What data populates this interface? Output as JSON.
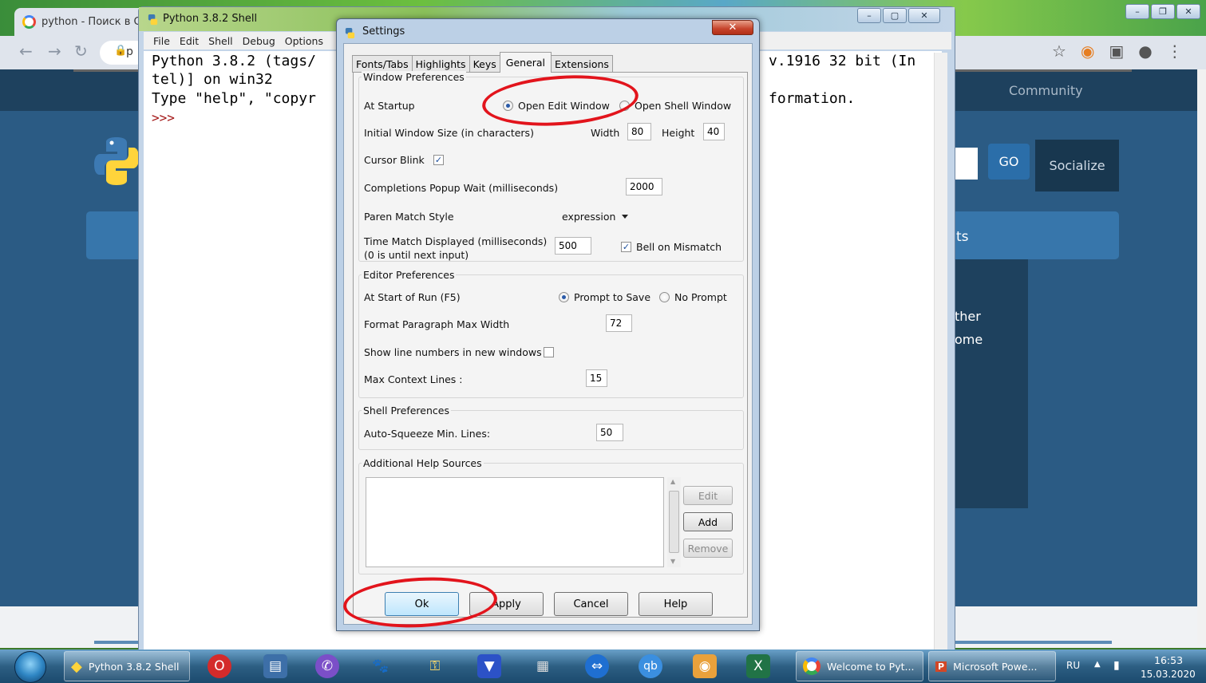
{
  "chrome": {
    "tab_title": "python - Поиск в G",
    "omnibox_text": "p"
  },
  "site": {
    "community": "Community",
    "go": "GO",
    "socialize": "Socialize",
    "band_text": "ts",
    "text_1": "ther",
    "text_2": "ome"
  },
  "shell": {
    "title": "Python 3.8.2 Shell",
    "menu": [
      "File",
      "Edit",
      "Shell",
      "Debug",
      "Options"
    ],
    "lines": [
      "Python 3.8.2 (tags/",
      "tel)] on win32",
      "Type \"help\", \"copyr",
      ">>>"
    ],
    "line_right_1": "v.1916 32 bit (In",
    "line_right_3": "formation."
  },
  "settings": {
    "title": "Settings",
    "close": "✕",
    "tabs": [
      "Fonts/Tabs",
      "Highlights",
      "Keys",
      "General",
      "Extensions"
    ],
    "active_tab": "General",
    "window_prefs": {
      "group": "Window Preferences",
      "at_startup": "At Startup",
      "open_edit": "Open Edit Window",
      "open_shell": "Open Shell Window",
      "startup_choice": "Open Edit Window",
      "initial_size": "Initial Window Size  (in characters)",
      "width_label": "Width",
      "width_value": "80",
      "height_label": "Height",
      "height_value": "40",
      "cursor_blink": "Cursor Blink",
      "cursor_blink_checked": true,
      "completions_wait": "Completions Popup Wait (milliseconds)",
      "completions_value": "2000",
      "paren_style": "Paren Match Style",
      "paren_value": "expression",
      "time_match_1": "Time Match Displayed (milliseconds)",
      "time_match_2": "(0 is until next input)",
      "time_match_value": "500",
      "bell_mismatch": "Bell on Mismatch",
      "bell_checked": true
    },
    "editor_prefs": {
      "group": "Editor Preferences",
      "start_of_run": "At Start of Run (F5)",
      "prompt_save": "Prompt to Save",
      "no_prompt": "No Prompt",
      "run_choice": "Prompt to Save",
      "format_width": "Format Paragraph Max Width",
      "format_width_value": "72",
      "line_numbers": "Show line numbers in new windows",
      "line_numbers_checked": false,
      "max_context": "Max Context Lines :",
      "max_context_value": "15"
    },
    "shell_prefs": {
      "group": "Shell Preferences",
      "auto_squeeze": "Auto-Squeeze Min. Lines:",
      "auto_squeeze_value": "50"
    },
    "help_sources": {
      "group": "Additional Help Sources",
      "edit": "Edit",
      "add": "Add",
      "remove": "Remove"
    },
    "buttons": {
      "ok": "Ok",
      "apply": "Apply",
      "cancel": "Cancel",
      "help": "Help"
    }
  },
  "taskbar": {
    "python_shell": "Python 3.8.2 Shell",
    "welcome": "Welcome to Pyt...",
    "powerpoint": "Microsoft Powe...",
    "lang": "RU",
    "time": "16:53",
    "date": "15.03.2020"
  },
  "colors": {
    "annotation": "#e2141c",
    "site_blue": "#2b5b84",
    "taskbar": "#2d5f83"
  }
}
